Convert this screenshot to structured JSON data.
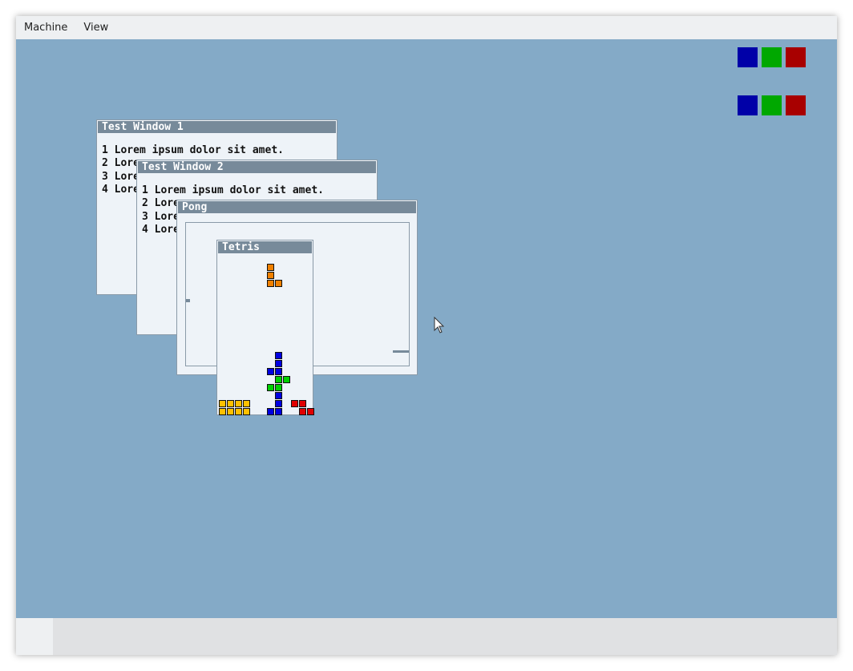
{
  "menubar": {
    "items": [
      "Machine",
      "View"
    ]
  },
  "desktop": {
    "background": "#84aac7",
    "swatch_rows": [
      [
        "#0000a8",
        "#00a800",
        "#a80000"
      ],
      [
        "#0000a8",
        "#00a800",
        "#a80000"
      ]
    ]
  },
  "windows": {
    "test1": {
      "title": "Test Window 1",
      "lines": [
        "1 Lorem ipsum dolor sit amet.",
        "2 Lore",
        "3 Lore",
        "4 Lore"
      ]
    },
    "test2": {
      "title": "Test Window 2",
      "lines": [
        "1 Lorem ipsum dolor sit amet.",
        "2 Lore",
        "3 Lore",
        "4 Lore"
      ]
    },
    "pong": {
      "title": "Pong"
    },
    "tetris": {
      "title": "Tetris",
      "colors": {
        "orange": "#f08000",
        "blue": "#0000e0",
        "green": "#00d000",
        "yellow": "#ffc000",
        "red": "#e00000"
      },
      "falling_piece": "orange L-piece",
      "stack_colors": [
        "blue",
        "green",
        "yellow",
        "red"
      ]
    }
  },
  "cursor": {
    "icon": "arrow-cursor-icon"
  }
}
